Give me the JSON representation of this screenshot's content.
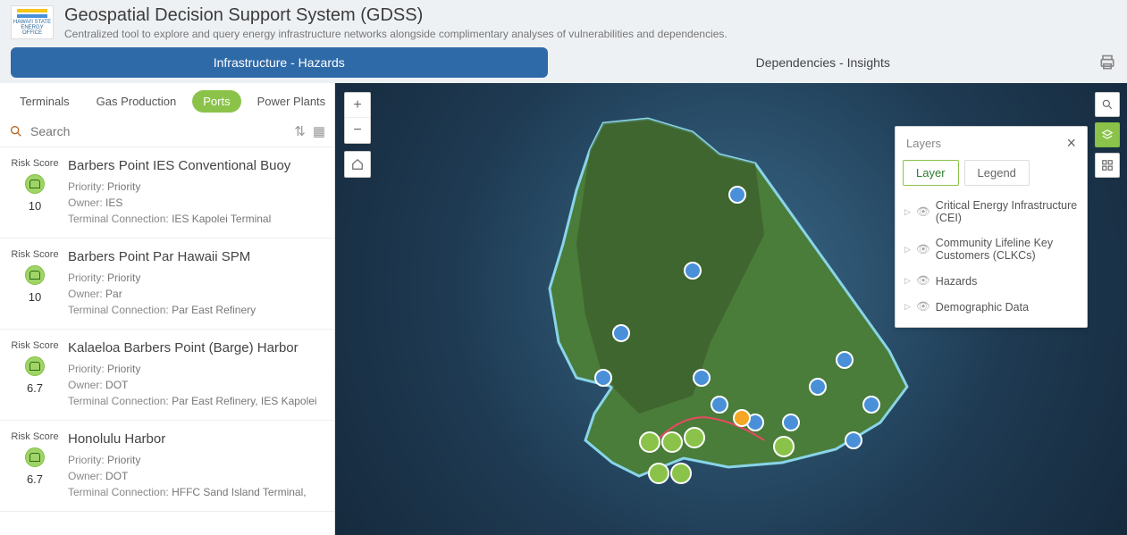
{
  "header": {
    "logo_text": "HAWAI'I STATE ENERGY OFFICE",
    "title": "Geospatial Decision Support System (GDSS)",
    "subtitle": "Centralized tool to explore and query energy infrastructure networks alongside complimentary analyses of vulnerabilities and dependencies."
  },
  "main_tabs": {
    "active": "Infrastructure - Hazards",
    "inactive": "Dependencies - Insights"
  },
  "subtabs": [
    "Terminals",
    "Gas Production",
    "Ports",
    "Power Plants"
  ],
  "subtab_active_index": 2,
  "search": {
    "placeholder": "Search"
  },
  "risk_label": "Risk Score",
  "items": [
    {
      "title": "Barbers Point IES Conventional Buoy",
      "score": "10",
      "priority_label": "Priority:",
      "priority": "Priority",
      "owner_label": "Owner:",
      "owner": "IES",
      "conn_label": "Terminal Connection:",
      "conn": "IES Kapolei Terminal"
    },
    {
      "title": "Barbers Point Par Hawaii SPM",
      "score": "10",
      "priority_label": "Priority:",
      "priority": "Priority",
      "owner_label": "Owner:",
      "owner": "Par",
      "conn_label": "Terminal Connection:",
      "conn": "Par East Refinery"
    },
    {
      "title": "Kalaeloa Barbers Point (Barge) Harbor",
      "score": "6.7",
      "priority_label": "Priority:",
      "priority": "Priority",
      "owner_label": "Owner:",
      "owner": "DOT",
      "conn_label": "Terminal Connection:",
      "conn": "Par East Refinery, IES Kapolei"
    },
    {
      "title": "Honolulu Harbor",
      "score": "6.7",
      "priority_label": "Priority:",
      "priority": "Priority",
      "owner_label": "Owner:",
      "owner": "DOT",
      "conn_label": "Terminal Connection:",
      "conn": "HFFC Sand Island Terminal,"
    }
  ],
  "layers_panel": {
    "title": "Layers",
    "tabs": {
      "active": "Layer",
      "other": "Legend"
    },
    "items": [
      "Critical Energy Infrastructure (CEI)",
      "Community Lifeline Key Customers (CLKCs)",
      "Hazards",
      "Demographic Data"
    ]
  }
}
